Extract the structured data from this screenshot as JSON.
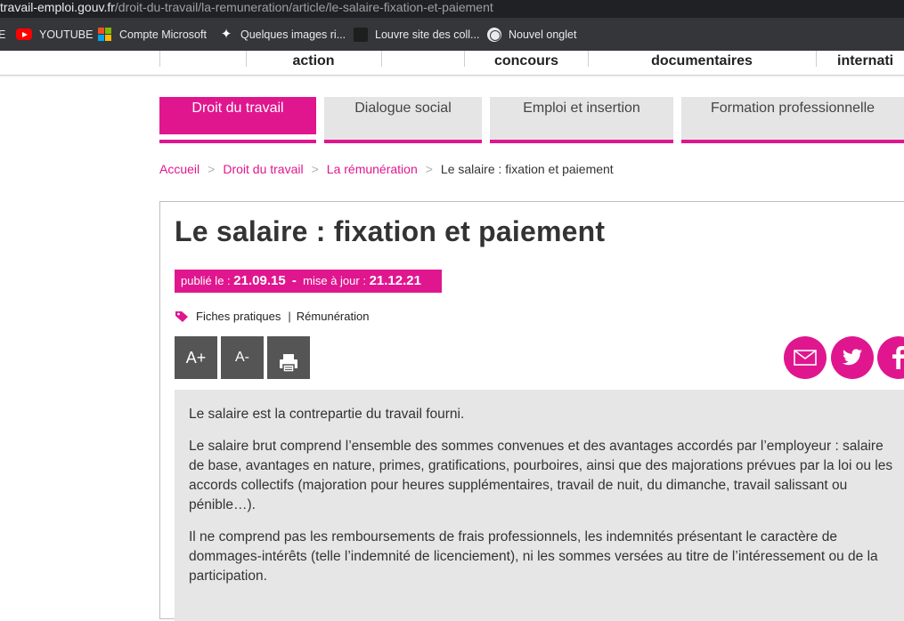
{
  "browser": {
    "url_host": "travail-emploi.gouv.fr",
    "url_path": "/droit-du-travail/la-remuneration/article/le-salaire-fixation-et-paiement",
    "bookmarks": [
      {
        "label": "E",
        "icon": "apps-icon"
      },
      {
        "label": "YOUTUBE",
        "icon": "youtube-icon"
      },
      {
        "label": "Compte Microsoft",
        "icon": "microsoft-icon"
      },
      {
        "label": "Quelques images ri...",
        "icon": "star-icon"
      },
      {
        "label": "Louvre site des coll...",
        "icon": "louvre-icon"
      },
      {
        "label": "Nouvel onglet",
        "icon": "globe-icon"
      }
    ]
  },
  "topnav": {
    "items": [
      "action",
      "concours",
      "documentaires",
      "internati"
    ]
  },
  "tabs": [
    {
      "label": "Droit du travail",
      "active": true
    },
    {
      "label": "Dialogue social",
      "active": false
    },
    {
      "label": "Emploi et insertion",
      "active": false
    },
    {
      "label": "Formation professionnelle",
      "active": false
    }
  ],
  "breadcrumb": {
    "items": [
      "Accueil",
      "Droit du travail",
      "La rémunération"
    ],
    "separator": ">",
    "current": "Le salaire : fixation et paiement"
  },
  "article": {
    "title": "Le salaire : fixation et paiement",
    "published_label": "publié le :",
    "published_date": "21.09.15",
    "dash": "-",
    "updated_label": "mise à jour :",
    "updated_date": "21.12.21",
    "tags": [
      "Fiches pratiques",
      "Rémunération"
    ],
    "tag_separator": "|",
    "tools": {
      "font_up": "A+",
      "font_down": "A-"
    },
    "paragraphs": [
      "Le salaire est la contrepartie du travail fourni.",
      "Le salaire brut comprend l’ensemble des sommes convenues et des avantages accordés par l’employeur : salaire de base, avantages en nature, primes, gratifications, pourboires, ainsi que des majorations prévues par la loi ou les accords collectifs (majoration pour heures supplémentaires, travail de nuit, du dimanche, travail salissant ou pénible…).",
      "Il ne comprend pas les remboursements de frais professionnels, les indemnités présentant le caractère de dommages-intérêts (telle l’indemnité de licenciement), ni les sommes versées au titre de l’intéressement ou de la participation."
    ]
  },
  "colors": {
    "accent": "#e0168f",
    "tool_bg": "#555555",
    "content_bg": "#e6e6e6",
    "chrome_dark": "#202124",
    "bookmarks_bg": "#35363a"
  }
}
